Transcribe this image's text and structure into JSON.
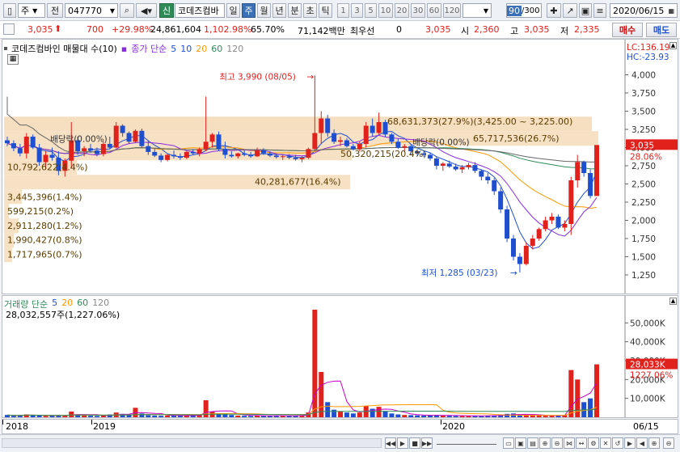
{
  "toolbar": {
    "type_select": "주",
    "prev_label": "전",
    "code": "047770",
    "new_badge": "신",
    "stock_name": "코데즈컴바",
    "period_tabs": [
      {
        "label": "일",
        "selected": false
      },
      {
        "label": "주",
        "selected": true
      },
      {
        "label": "월",
        "selected": false
      },
      {
        "label": "년",
        "selected": false
      },
      {
        "label": "분",
        "selected": false
      },
      {
        "label": "초",
        "selected": false
      },
      {
        "label": "틱",
        "selected": false
      }
    ],
    "minute_options": [
      "1",
      "3",
      "5",
      "10",
      "20",
      "30",
      "60",
      "120"
    ],
    "count_value": "90",
    "count_total": "/300",
    "date": "2020/06/15"
  },
  "quote": {
    "price": "3,035",
    "change": "700",
    "change_pct": "+29.98%",
    "volume": "24,861,604",
    "volume_pct": "1,102.98%",
    "turnover": "65.70%",
    "amount": "71,142백만",
    "pref_label": "최우선",
    "pref_value": "0",
    "ask_price": "3,035",
    "open_label": "시",
    "open": "2,360",
    "high_label": "고",
    "high": "3,035",
    "low_label": "저",
    "low": "2,335",
    "buy_label": "매수",
    "sell_label": "매도"
  },
  "price_chart": {
    "legend_title": "코데즈컴바인 매물대 수(10)",
    "legend_ma": "종가 단순",
    "ma_periods": [
      "5",
      "10",
      "20",
      "60",
      "120"
    ],
    "ma_colors": [
      "#1f4fd1",
      "#ff9900",
      "#2e8b57",
      "#8a2be2"
    ],
    "lc_label": "LC:136.19",
    "hc_label": "HC:-23.93",
    "price_tag": "3,035",
    "pct_tag": "28.06%",
    "high_annot": "최고 3,990 (08/05)",
    "low_annot": "최저 1,285 (03/23)",
    "dividend_labels": [
      "배당락(0.00%)",
      "배당락(0.00%)"
    ],
    "volume_profile": [
      {
        "label": "68,631,373(27.9%)(3,425.00 ~ 3,225.00)"
      },
      {
        "label": "65,717,536(26.7%)"
      },
      {
        "label": "50,320,215(20.4%)"
      },
      {
        "label": "10,792,622(4.4%)"
      },
      {
        "label": "40,281,677(16.4%)"
      },
      {
        "label": "3,445,396(1.4%)"
      },
      {
        "label": "599,215(0.2%)"
      },
      {
        "label": "2,911,280(1.2%)"
      },
      {
        "label": "1,990,427(0.8%)"
      },
      {
        "label": "1,717,965(0.7%)"
      }
    ],
    "y_ticks": [
      "4,000",
      "3,750",
      "3,500",
      "3,250",
      "3,000",
      "2,750",
      "2,500",
      "2,250",
      "2,000",
      "1,750",
      "1,500",
      "1,250"
    ]
  },
  "volume_chart": {
    "legend": "거래량 단순",
    "ma_periods": [
      "5",
      "20",
      "60",
      "120"
    ],
    "value_label": "28,032,557주(1,227.06%)",
    "tag_value": "28,033K",
    "tag_pct": "1227.06%",
    "y_ticks": [
      "50,000K",
      "40,000K",
      "30,000K",
      "20,000K",
      "10,000K"
    ]
  },
  "x_axis": {
    "labels": [
      "2018",
      "2019",
      "2020"
    ],
    "right_label": "06/15"
  },
  "chart_data": {
    "type": "candlestick",
    "ylim": [
      1150,
      4150
    ],
    "high": 3990,
    "low": 1285,
    "last": 3035,
    "candles": [
      [
        3100,
        3150,
        3020,
        3060
      ],
      [
        3060,
        3100,
        2950,
        2990
      ],
      [
        2990,
        3050,
        2880,
        2920
      ],
      [
        2920,
        3200,
        2850,
        3150
      ],
      [
        3150,
        3180,
        2980,
        3000
      ],
      [
        3000,
        3050,
        2750,
        2800
      ],
      [
        2800,
        2950,
        2700,
        2900
      ],
      [
        2900,
        3000,
        2820,
        2860
      ],
      [
        2860,
        2950,
        2620,
        2680
      ],
      [
        2680,
        2850,
        2600,
        2820
      ],
      [
        2820,
        3350,
        2720,
        3100
      ],
      [
        3100,
        3150,
        2900,
        2950
      ],
      [
        2950,
        3020,
        2880,
        2990
      ],
      [
        2990,
        3050,
        2930,
        2960
      ],
      [
        2960,
        3000,
        2880,
        2910
      ],
      [
        2910,
        3080,
        2880,
        3050
      ],
      [
        3050,
        3150,
        2980,
        3000
      ],
      [
        3000,
        3350,
        2990,
        3300
      ],
      [
        3300,
        3320,
        3150,
        3200
      ],
      [
        3200,
        3220,
        3050,
        3080
      ],
      [
        3080,
        3250,
        3060,
        3230
      ],
      [
        3230,
        3260,
        3000,
        3020
      ],
      [
        3020,
        3100,
        2900,
        2940
      ],
      [
        2940,
        2980,
        2870,
        2890
      ],
      [
        2890,
        2920,
        2800,
        2830
      ],
      [
        2830,
        2910,
        2810,
        2900
      ],
      [
        2900,
        2960,
        2850,
        2880
      ],
      [
        2880,
        2920,
        2830,
        2860
      ],
      [
        2860,
        2950,
        2840,
        2940
      ],
      [
        2940,
        2980,
        2900,
        2920
      ],
      [
        2920,
        3000,
        2880,
        2980
      ],
      [
        2980,
        3700,
        2950,
        3080
      ],
      [
        3080,
        3200,
        3000,
        3180
      ],
      [
        3180,
        3220,
        2950,
        2980
      ],
      [
        2980,
        3080,
        2850,
        2900
      ],
      [
        2900,
        2950,
        2860,
        2880
      ],
      [
        2880,
        2930,
        2850,
        2920
      ],
      [
        2920,
        2960,
        2880,
        2900
      ],
      [
        2900,
        2940,
        2860,
        2880
      ],
      [
        2880,
        3000,
        2870,
        2960
      ],
      [
        2960,
        2990,
        2900,
        2920
      ],
      [
        2920,
        2950,
        2870,
        2890
      ],
      [
        2890,
        2920,
        2850,
        2870
      ],
      [
        2870,
        2900,
        2830,
        2880
      ],
      [
        2880,
        2910,
        2840,
        2860
      ],
      [
        2860,
        2900,
        2820,
        2840
      ],
      [
        2840,
        2880,
        2800,
        2860
      ],
      [
        2860,
        3000,
        2840,
        2980
      ],
      [
        2980,
        3990,
        2950,
        3200
      ],
      [
        3200,
        3500,
        3050,
        3400
      ],
      [
        3400,
        3450,
        3150,
        3200
      ],
      [
        3200,
        3250,
        3050,
        3080
      ],
      [
        3080,
        3150,
        3020,
        3100
      ],
      [
        3100,
        3130,
        3000,
        3020
      ],
      [
        3020,
        3050,
        2960,
        2980
      ],
      [
        2980,
        3080,
        2950,
        3050
      ],
      [
        3050,
        3350,
        3000,
        3300
      ],
      [
        3300,
        3400,
        3150,
        3200
      ],
      [
        3200,
        3480,
        3180,
        3350
      ],
      [
        3350,
        3380,
        3150,
        3180
      ],
      [
        3180,
        3200,
        3050,
        3080
      ],
      [
        3080,
        3120,
        2980,
        3000
      ],
      [
        3000,
        3050,
        2950,
        3020
      ],
      [
        3020,
        3050,
        2900,
        2950
      ],
      [
        2950,
        2980,
        2880,
        2920
      ],
      [
        2920,
        2960,
        2870,
        2900
      ],
      [
        2900,
        2930,
        2820,
        2850
      ],
      [
        2850,
        2880,
        2700,
        2750
      ],
      [
        2750,
        2800,
        2680,
        2780
      ],
      [
        2780,
        2820,
        2720,
        2740
      ],
      [
        2740,
        2780,
        2680,
        2700
      ],
      [
        2700,
        2760,
        2650,
        2730
      ],
      [
        2730,
        2790,
        2700,
        2760
      ],
      [
        2760,
        2800,
        2650,
        2680
      ],
      [
        2680,
        2700,
        2550,
        2600
      ],
      [
        2600,
        2650,
        2500,
        2550
      ],
      [
        2550,
        2580,
        2350,
        2400
      ],
      [
        2400,
        2450,
        2100,
        2150
      ],
      [
        2150,
        2200,
        1700,
        1750
      ],
      [
        1750,
        1800,
        1450,
        1500
      ],
      [
        1500,
        1550,
        1285,
        1400
      ],
      [
        1400,
        1700,
        1380,
        1650
      ],
      [
        1650,
        1800,
        1600,
        1750
      ],
      [
        1750,
        1900,
        1720,
        1880
      ],
      [
        1880,
        2050,
        1850,
        2000
      ],
      [
        2000,
        2100,
        1950,
        2050
      ],
      [
        2050,
        2080,
        1880,
        1900
      ],
      [
        1900,
        2000,
        1850,
        1950
      ],
      [
        1950,
        2600,
        1800,
        2550
      ],
      [
        2550,
        2900,
        2450,
        2800
      ],
      [
        2800,
        2820,
        2600,
        2650
      ],
      [
        2650,
        2700,
        2300,
        2335
      ],
      [
        2335,
        3035,
        2335,
        3035
      ]
    ],
    "volumes_k": [
      1200,
      800,
      900,
      1500,
      1100,
      900,
      700,
      800,
      1000,
      900,
      3000,
      1500,
      900,
      800,
      700,
      1100,
      1500,
      2500,
      1800,
      1200,
      5000,
      2000,
      1100,
      900,
      800,
      900,
      1000,
      800,
      700,
      800,
      1500,
      9000,
      3000,
      2000,
      1500,
      1200,
      900,
      800,
      700,
      900,
      800,
      700,
      900,
      800,
      700,
      800,
      1000,
      2500,
      57000,
      24000,
      8000,
      4000,
      3000,
      2500,
      2000,
      2500,
      6000,
      4500,
      5500,
      3000,
      2000,
      1500,
      1200,
      1100,
      1000,
      900,
      1000,
      1200,
      900,
      800,
      700,
      600,
      700,
      800,
      700,
      900,
      1000,
      1200,
      1800,
      2000,
      1500,
      1200,
      1000,
      900,
      800,
      700,
      900,
      1100,
      25000,
      20000,
      8000,
      10000,
      28033
    ]
  }
}
